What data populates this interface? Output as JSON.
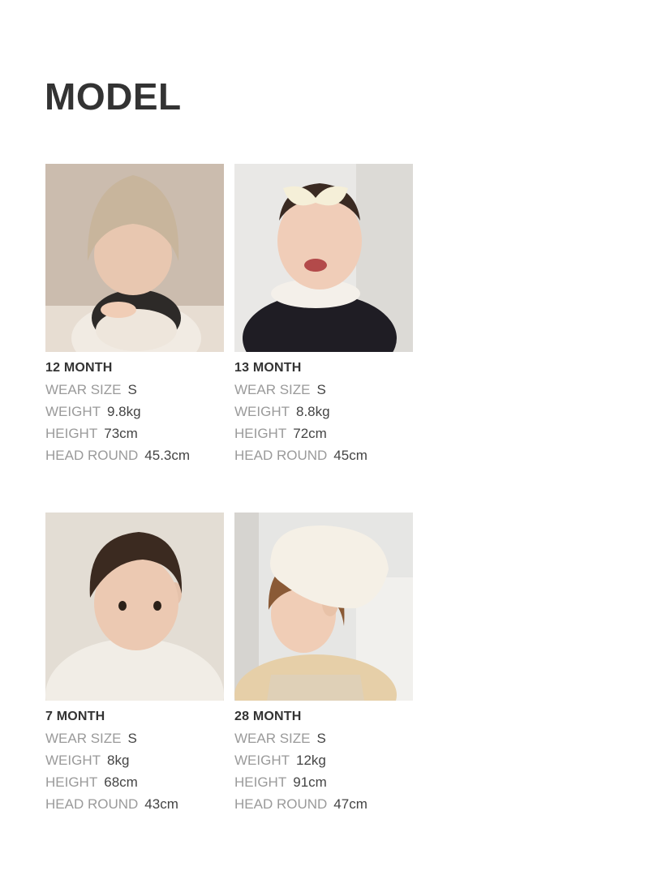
{
  "title": "MODEL",
  "models": [
    {
      "age": "12 MONTH",
      "photo_desc": "baby-in-knit-bonnet-photo",
      "rows": [
        {
          "label": "WEAR SIZE",
          "value": "S"
        },
        {
          "label": "WEIGHT",
          "value": "9.8kg"
        },
        {
          "label": "HEIGHT",
          "value": "73cm"
        },
        {
          "label": "HEAD ROUND",
          "value": "45.3cm"
        }
      ]
    },
    {
      "age": "13 MONTH",
      "photo_desc": "smiling-baby-with-bow-headband-photo",
      "rows": [
        {
          "label": "WEAR SIZE",
          "value": "S"
        },
        {
          "label": "WEIGHT",
          "value": "8.8kg"
        },
        {
          "label": "HEIGHT",
          "value": "72cm"
        },
        {
          "label": "HEAD ROUND",
          "value": "45cm"
        }
      ]
    },
    {
      "age": "7 MONTH",
      "photo_desc": "baby-in-fleece-hood-photo",
      "rows": [
        {
          "label": "WEAR SIZE",
          "value": "S"
        },
        {
          "label": "WEIGHT",
          "value": "8kg"
        },
        {
          "label": "HEIGHT",
          "value": "68cm"
        },
        {
          "label": "HEAD ROUND",
          "value": "43cm"
        }
      ]
    },
    {
      "age": "28 MONTH",
      "photo_desc": "toddler-in-beret-photo",
      "rows": [
        {
          "label": "WEAR SIZE",
          "value": "S"
        },
        {
          "label": "WEIGHT",
          "value": "12kg"
        },
        {
          "label": "HEIGHT",
          "value": "91cm"
        },
        {
          "label": "HEAD ROUND",
          "value": "47cm"
        }
      ]
    }
  ],
  "colors": {
    "title": "#333333",
    "label": "#9a9a9a",
    "value": "#444444"
  }
}
